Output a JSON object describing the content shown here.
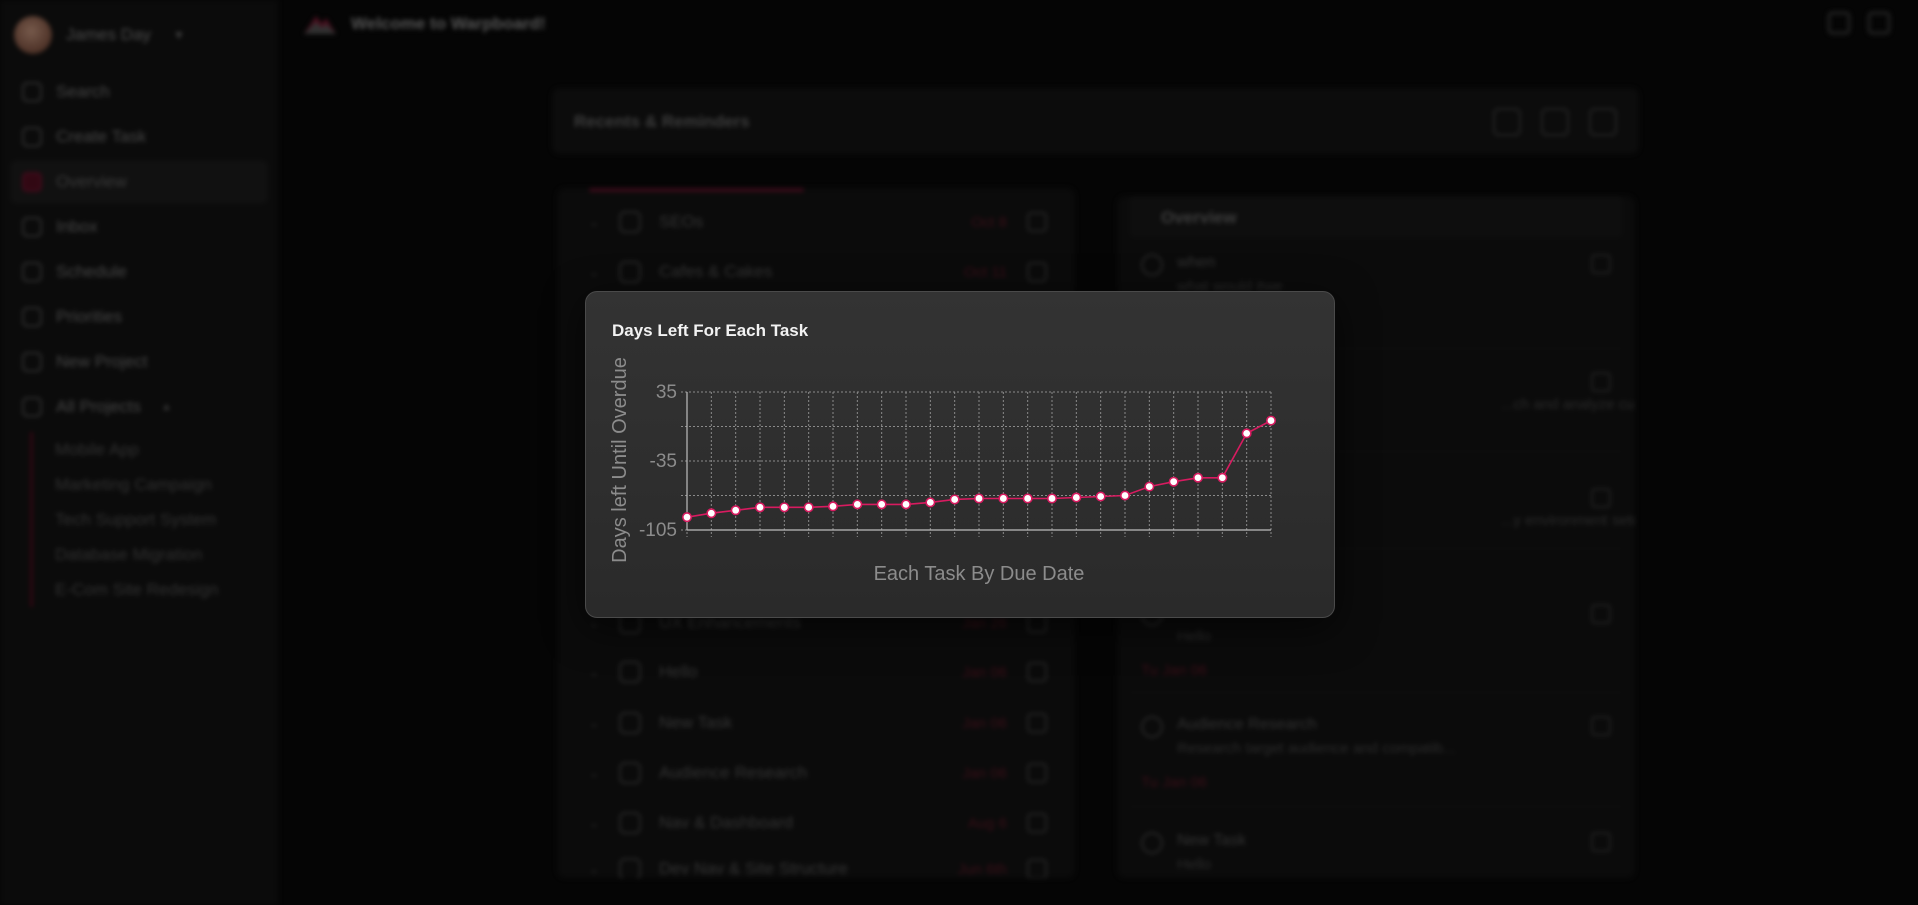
{
  "user": {
    "name": "James Day"
  },
  "sidebar": {
    "items": [
      {
        "label": "Search",
        "icon": "search-icon"
      },
      {
        "label": "Create Task",
        "icon": "plus-icon"
      },
      {
        "label": "Overview",
        "icon": "overview-icon",
        "active": true
      },
      {
        "label": "Inbox",
        "icon": "inbox-icon"
      },
      {
        "label": "Schedule",
        "icon": "calendar-icon"
      },
      {
        "label": "Priorities",
        "icon": "priority-icon"
      },
      {
        "label": "New Project",
        "icon": "folder-plus-icon"
      },
      {
        "label": "All Projects",
        "icon": "folder-icon"
      }
    ],
    "projects": [
      "Mobile App",
      "Marketing Campaign",
      "Tech Support System",
      "Database Migration",
      "E-Com Site Redesign"
    ]
  },
  "header": {
    "welcome": "Welcome to Warpboard!"
  },
  "main": {
    "title": "Recents & Reminders"
  },
  "tasks": [
    {
      "name": "SEOs",
      "date": "Oct 8"
    },
    {
      "name": "Cafes & Cakes",
      "date": "Oct 11"
    },
    {
      "name": "UX Enhancements",
      "date": "Jan 26"
    },
    {
      "name": "Hello",
      "date": "Jan 06"
    },
    {
      "name": "New Task",
      "date": "Jan 06"
    },
    {
      "name": "Audience Research",
      "date": "Jan 06"
    },
    {
      "name": "Nav & Dashboard",
      "date": "Aug 6"
    },
    {
      "name": "Dev Nav & Site Structure",
      "date": "Jun 6th"
    }
  ],
  "overview": {
    "title": "Overview",
    "items": [
      {
        "title": "when",
        "desc": "what would itwe",
        "date": ""
      },
      {
        "title": "",
        "desc": "...ch and analyze cus...",
        "date": ""
      },
      {
        "title": "",
        "desc": "...y environment setup",
        "date": ""
      },
      {
        "title": "",
        "desc": "Hello",
        "date": "Tu Jan 06"
      },
      {
        "title": "Audience Research",
        "desc": "Research target audience and compatib...",
        "date": "Tu Jan 06"
      },
      {
        "title": "New Task",
        "desc": "Hello",
        "date": ""
      }
    ]
  },
  "chart_data": {
    "type": "line",
    "title": "Days Left For Each Task",
    "xlabel": "Each Task By Due Date",
    "ylabel": "Days left Until Overdue",
    "ylim": [
      -105,
      35
    ],
    "yticks": [
      35,
      -35,
      -105
    ],
    "grid": true,
    "color": "#d81b60",
    "values": [
      -92,
      -88,
      -85,
      -82,
      -82,
      -82,
      -81,
      -79,
      -79,
      -79,
      -77,
      -74,
      -73,
      -73,
      -73,
      -73,
      -72,
      -71,
      -70,
      -61,
      -56,
      -52,
      -52,
      -7,
      6
    ]
  }
}
